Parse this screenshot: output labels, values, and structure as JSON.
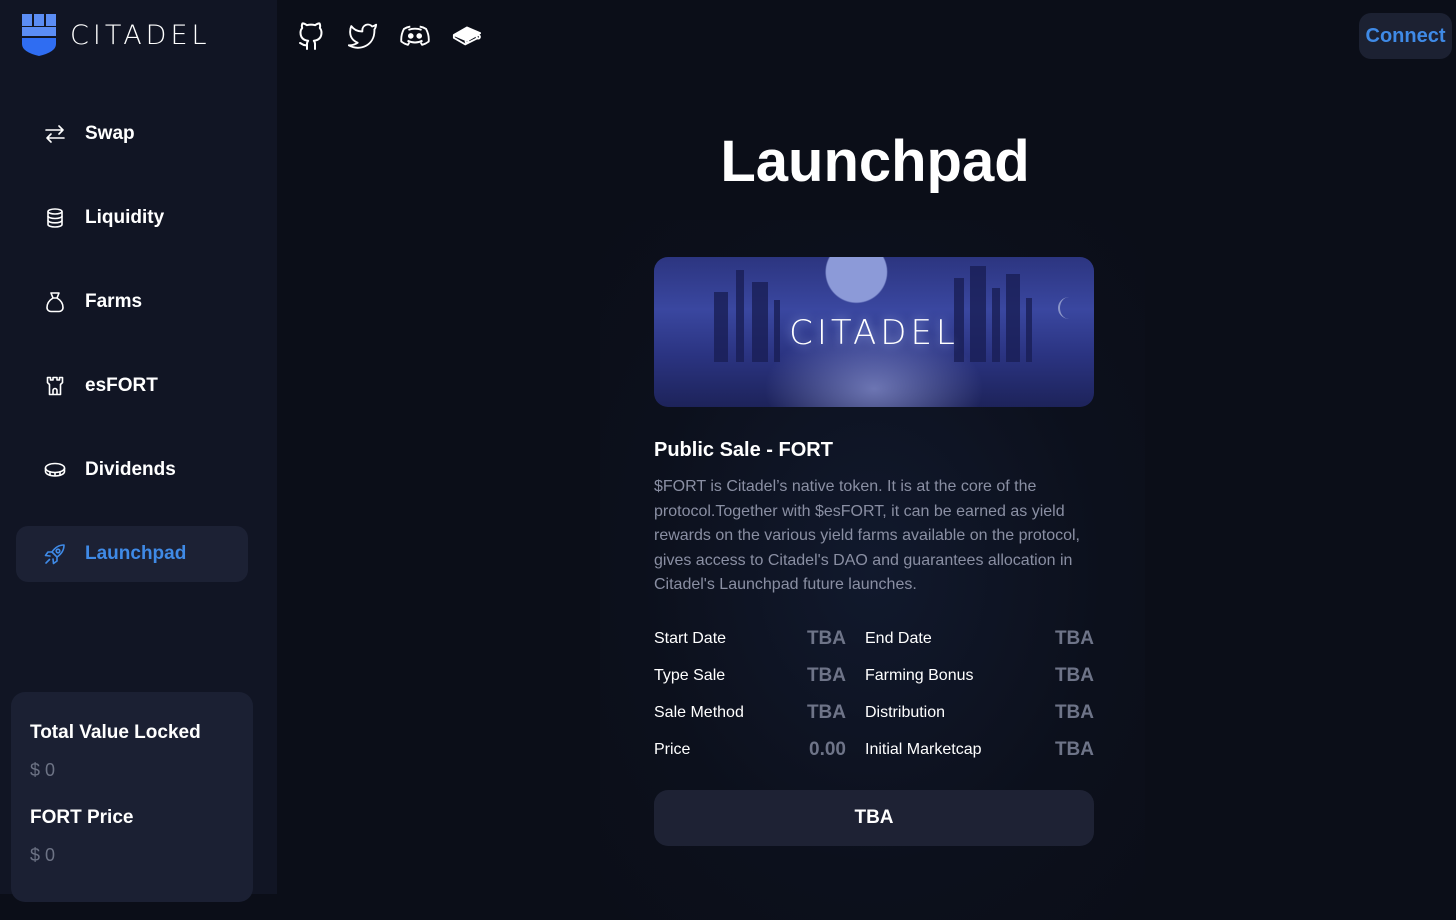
{
  "brand": {
    "name": "CITADEL",
    "accent": "#3f8ae6",
    "logo_blue": "#2f6df2"
  },
  "social_icons": [
    {
      "name": "github-icon"
    },
    {
      "name": "twitter-icon"
    },
    {
      "name": "discord-icon"
    },
    {
      "name": "docs-book-icon"
    }
  ],
  "header": {
    "connect_label": "Connect"
  },
  "sidebar": {
    "items": [
      {
        "label": "Swap",
        "icon": "swap-arrows-icon",
        "active": false
      },
      {
        "label": "Liquidity",
        "icon": "database-icon",
        "active": false
      },
      {
        "label": "Farms",
        "icon": "money-bag-icon",
        "active": false
      },
      {
        "label": "esFORT",
        "icon": "castle-tower-icon",
        "active": false
      },
      {
        "label": "Dividends",
        "icon": "coin-icon",
        "active": false
      },
      {
        "label": "Launchpad",
        "icon": "rocket-icon",
        "active": true
      }
    ],
    "stats": [
      {
        "label": "Total Value Locked",
        "value": "$ 0"
      },
      {
        "label": "FORT Price",
        "value": "$ 0"
      }
    ]
  },
  "main": {
    "title": "Launchpad",
    "banner_text": "CITADEL",
    "sale": {
      "title": "Public Sale - FORT",
      "description": "$FORT is Citadel’s native token. It is at the core of the protocol.Together with $esFORT, it can be earned as yield rewards on the various yield farms available on the protocol, gives access to Citadel's DAO and guarantees allocation in Citadel's Launchpad future launches.",
      "details_left": [
        {
          "label": "Start Date",
          "value": "TBA"
        },
        {
          "label": "Type Sale",
          "value": "TBA"
        },
        {
          "label": "Sale Method",
          "value": "TBA"
        },
        {
          "label": "Price",
          "value": "0.00"
        }
      ],
      "details_right": [
        {
          "label": "End Date",
          "value": "TBA"
        },
        {
          "label": "Farming Bonus",
          "value": "TBA"
        },
        {
          "label": "Distribution",
          "value": "TBA"
        },
        {
          "label": "Initial Marketcap",
          "value": "TBA"
        }
      ],
      "action_label": "TBA"
    }
  }
}
